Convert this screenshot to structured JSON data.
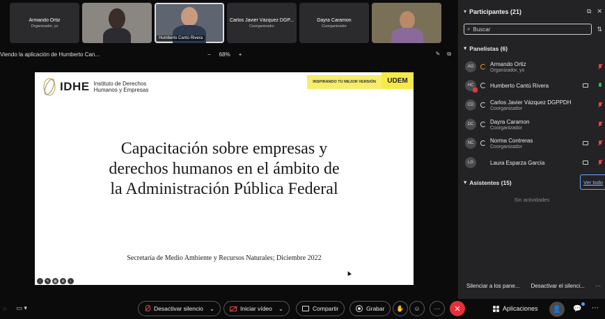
{
  "video_strip": [
    {
      "name": "Armando Ortiz",
      "role": "Organizador, yo",
      "video": false
    },
    {
      "name": "",
      "role": "",
      "video": true
    },
    {
      "name": "Humberto Cantú Rivera",
      "role": "",
      "video": true,
      "active": true
    },
    {
      "name": "Carlos Javier Vázquez DGP...",
      "role": "Coorganizador",
      "video": false
    },
    {
      "name": "Dayra Caramon",
      "role": "Coorganizador",
      "video": false
    },
    {
      "name": "",
      "role": "",
      "video": true
    }
  ],
  "share_bar": {
    "label": "Viendo la aplicación de Humberto Can...",
    "zoom_out": "−",
    "zoom": "68%",
    "zoom_in": "+"
  },
  "slide": {
    "logo_text": "IDHE",
    "logo_sub_1": "Instituto de Derechos",
    "logo_sub_2": "Humanos y Empresas",
    "tagline": "INSPIRANDO TU MEJOR VERSIÓN",
    "udem": "UDEM",
    "title_1": "Capacitación sobre empresas y",
    "title_2": "derechos humanos en el ámbito de",
    "title_3": "la Administración Pública Federal",
    "footer": "Secretaría de Medio Ambiente y Recursos Naturales; Diciembre 2022"
  },
  "panel": {
    "title": "Participantes (21)",
    "search_placeholder": "Buscar",
    "panelists_header": "Panelistas (6)",
    "panelists": [
      {
        "initials": "AO",
        "name": "Armando Ortiz",
        "role": "Organizador, yo",
        "camera": false,
        "mic": "muted"
      },
      {
        "initials": "HC",
        "name": "Humberto Cantú Rivera",
        "role": "",
        "camera": true,
        "mic": "on"
      },
      {
        "initials": "CD",
        "name": "Carlos Javier Vázquez DGPPDH",
        "role": "Coorganizador",
        "camera": false,
        "mic": "muted"
      },
      {
        "initials": "DC",
        "name": "Dayra Caramon",
        "role": "Coorganizador",
        "camera": false,
        "mic": "muted"
      },
      {
        "initials": "NC",
        "name": "Norma Contreras",
        "role": "Coorganizador",
        "camera": true,
        "mic": "muted"
      },
      {
        "initials": "LG",
        "name": "Laura Esparza García",
        "role": "",
        "camera": true,
        "mic": "muted"
      }
    ],
    "attendees_header": "Asistentes (15)",
    "view_all": "Ver todo",
    "no_activity": "Sin actividades",
    "mute_all": "Silenciar a los pane...",
    "unmute_all": "Desactivar el silenci...",
    "more": "···"
  },
  "toolbar": {
    "mute": "Desactivar silencio",
    "video": "Iniciar vídeo",
    "share": "Compartir",
    "record": "Grabar",
    "apps": "Aplicaciones",
    "more": "···"
  },
  "colors": {
    "end_call": "#e5303a",
    "muted": "#e04848",
    "unmuted": "#2bb65a",
    "accent_yellow": "#f6e94a",
    "link": "#8fbaff"
  }
}
